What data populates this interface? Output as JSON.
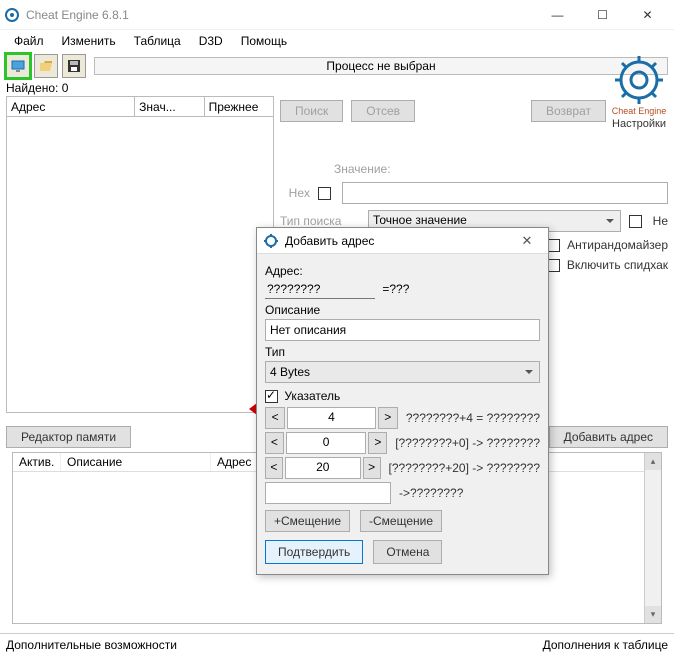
{
  "window": {
    "title": "Cheat Engine 6.8.1"
  },
  "menus": {
    "file": "Файл",
    "edit": "Изменить",
    "table": "Таблица",
    "d3d": "D3D",
    "help": "Помощь"
  },
  "toolbar": {
    "process_status": "Процесс не выбран"
  },
  "found": {
    "label": "Найдено:",
    "count": "0"
  },
  "results_table": {
    "col_addr": "Адрес",
    "col_value": "Знач...",
    "col_prev": "Прежнее"
  },
  "buttons": {
    "search": "Поиск",
    "sift": "Отсев",
    "revert": "Возврат",
    "memory_editor": "Редактор памяти",
    "add_address": "Добавить адрес"
  },
  "scan": {
    "value_label": "Значение:",
    "hex_label": "Hex",
    "type_label": "Тип поиска",
    "type_value": "Точное значение",
    "not_label": "Не",
    "antirandom": "Антирандомайзер",
    "speedhack": "Включить спидхак"
  },
  "logo": {
    "settings": "Настройки",
    "brand": "Cheat Engine"
  },
  "bottom_table": {
    "col_active": "Актив.",
    "col_desc": "Описание",
    "col_addr": "Адрес"
  },
  "status": {
    "left": "Дополнительные возможности",
    "right": "Дополнения к таблице"
  },
  "dialog": {
    "title": "Добавить адрес",
    "addr_label": "Адрес:",
    "addr_value": "????????",
    "addr_eq": "=???",
    "desc_label": "Описание",
    "desc_value": "Нет описания",
    "type_label": "Тип",
    "type_value": "4 Bytes",
    "pointer_label": "Указатель",
    "rows": [
      {
        "offset": "4",
        "expr": "????????+4 = ????????"
      },
      {
        "offset": "0",
        "expr": "[????????+0] -> ????????"
      },
      {
        "offset": "20",
        "expr": "[????????+20] -> ????????"
      }
    ],
    "base_expr": "->????????",
    "add_offset": "+Смещение",
    "rem_offset": "-Смещение",
    "ok": "Подтвердить",
    "cancel": "Отмена"
  }
}
